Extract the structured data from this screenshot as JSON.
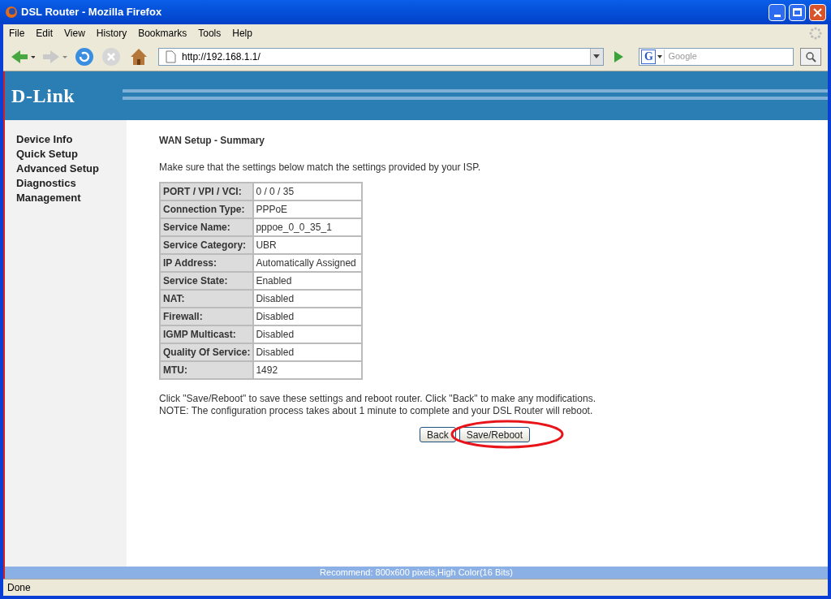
{
  "window": {
    "title": "DSL Router - Mozilla Firefox"
  },
  "menu": [
    "File",
    "Edit",
    "View",
    "History",
    "Bookmarks",
    "Tools",
    "Help"
  ],
  "address": {
    "value": "http://192.168.1.1/"
  },
  "search": {
    "placeholder": "Google",
    "engine": "G"
  },
  "brand": "D-Link",
  "sidebar": {
    "items": [
      "Device Info",
      "Quick Setup",
      "Advanced Setup",
      "Diagnostics",
      "Management"
    ]
  },
  "heading": "WAN Setup - Summary",
  "intro": "Make sure that the settings below match the settings provided by your ISP.",
  "summary": [
    {
      "label": "PORT / VPI / VCI:",
      "value": "0 / 0 / 35"
    },
    {
      "label": "Connection Type:",
      "value": "PPPoE"
    },
    {
      "label": "Service Name:",
      "value": "pppoe_0_0_35_1"
    },
    {
      "label": "Service Category:",
      "value": "UBR"
    },
    {
      "label": "IP Address:",
      "value": "Automatically Assigned"
    },
    {
      "label": "Service State:",
      "value": "Enabled"
    },
    {
      "label": "NAT:",
      "value": "Disabled"
    },
    {
      "label": "Firewall:",
      "value": "Disabled"
    },
    {
      "label": "IGMP Multicast:",
      "value": "Disabled"
    },
    {
      "label": "Quality Of Service:",
      "value": "Disabled"
    },
    {
      "label": "MTU:",
      "value": "1492"
    }
  ],
  "notes": [
    "Click \"Save/Reboot\" to save these settings and reboot router. Click \"Back\" to make any modifications.",
    "NOTE: The configuration process takes about 1 minute to complete and your DSL Router will reboot."
  ],
  "buttons": [
    {
      "label": "Back",
      "highlighted": false
    },
    {
      "label": "Save/Reboot",
      "highlighted": true
    }
  ],
  "footer": "Recommend: 800x600 pixels,High Color(16 Bits)",
  "status_bar": "Done"
}
